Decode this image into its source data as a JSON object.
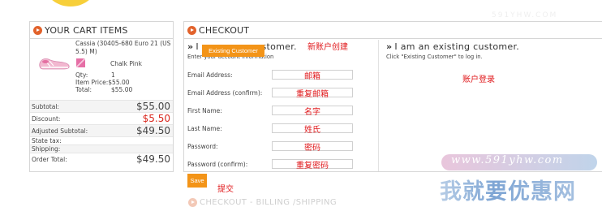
{
  "cart": {
    "title": "YOUR CART ITEMS",
    "item": {
      "name": "Cassia (30405-680 Euro 21 (US 5.5) M)",
      "color": "Chalk Pink",
      "qty_label": "Qty:",
      "qty": "1",
      "item_price_label": "Item Price:",
      "item_price": "$55.00",
      "total_label": "Total:",
      "total": "$55.00"
    },
    "totals": [
      {
        "label": "Subtotal:",
        "value": "$55.00",
        "size": "big",
        "red": false
      },
      {
        "label": "Discount:",
        "value": "$5.50",
        "size": "big",
        "red": true
      },
      {
        "label": "Adjusted Subtotal:",
        "value": "$49.50",
        "size": "big",
        "red": false
      },
      {
        "label": "State tax:",
        "value": "",
        "size": "small",
        "red": false
      },
      {
        "label": "Shipping:",
        "value": "",
        "size": "small",
        "red": false
      },
      {
        "label": "Order Total:",
        "value": "$49.50",
        "size": "big",
        "red": false
      }
    ]
  },
  "checkout": {
    "title": "CHECKOUT",
    "new_customer": {
      "title": "I am a new customer.",
      "arrow": "»",
      "annotation": "新账户创建",
      "subtitle": "Enter your account information"
    },
    "fields": [
      {
        "label": "Email Address:",
        "value": "邮箱"
      },
      {
        "label": "Email Address (confirm):",
        "value": "重复邮箱"
      },
      {
        "label": "First Name:",
        "value": "名字"
      },
      {
        "label": "Last Name:",
        "value": "姓氏"
      },
      {
        "label": "Password:",
        "value": "密码"
      },
      {
        "label": "Password (confirm):",
        "value": "重复密码"
      }
    ],
    "save_label": "Save",
    "save_annotation": "提交",
    "existing_customer": {
      "title": "I am an existing customer.",
      "arrow": "»",
      "subtitle": "Click \"Existing Customer\" to log in.",
      "button_label": "Existing Customer",
      "annotation": "账户登录"
    },
    "next_section_title": "CHECKOUT - BILLING /SHIPPING"
  },
  "watermark": {
    "url": "www.591yhw.com",
    "brand": "我就要优惠网",
    "faint": "591YHW.COM"
  },
  "colors": {
    "accent_orange": "#f39418",
    "bullet_orange": "#e2622b",
    "annotation_red": "#e0181b",
    "discount_red": "#d9261c"
  },
  "icons": {
    "section_bullet": "arrow-circle-icon",
    "product_image": "shoe-icon",
    "color_swatch": "swatch-icon"
  }
}
